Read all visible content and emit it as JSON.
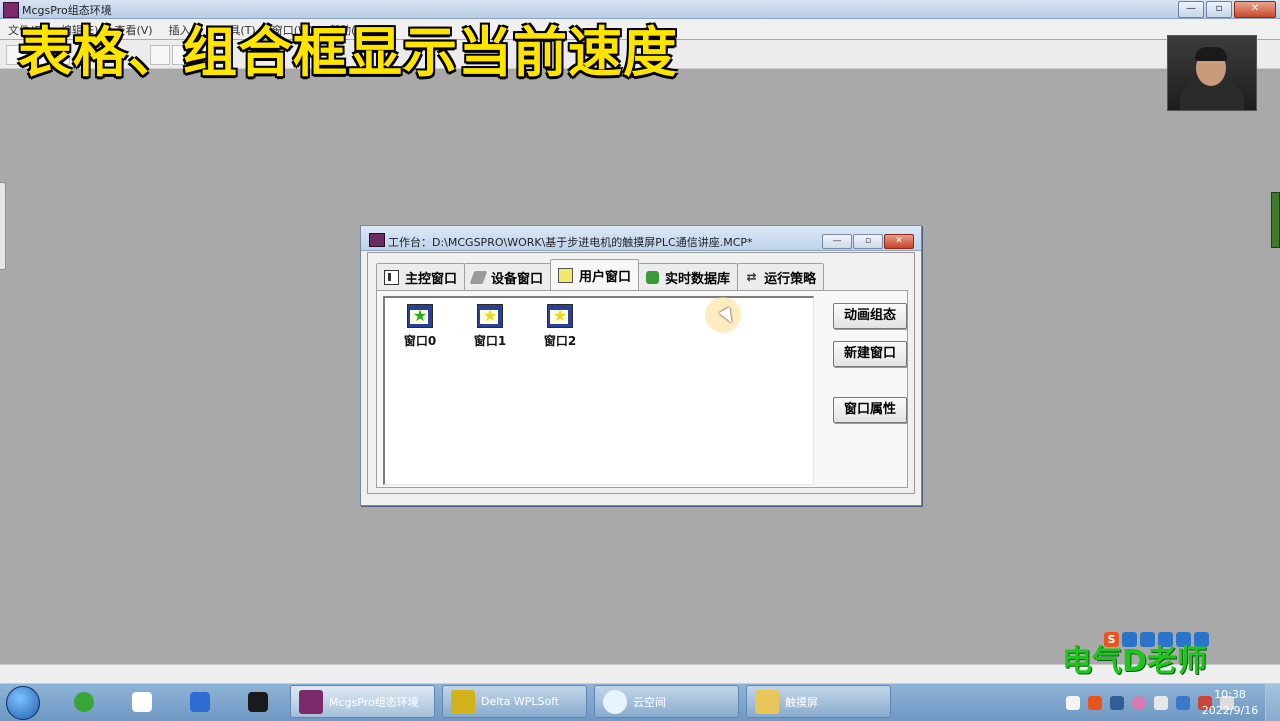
{
  "app": {
    "title": "McgsPro组态环境",
    "controls": {
      "minimize": "—",
      "maximize": "▫",
      "close": "✕"
    }
  },
  "menubar": [
    "文件(F)",
    "编辑(E)",
    "查看(V)",
    "插入(I)",
    "工具(T)",
    "窗口(W)",
    "帮助(H)"
  ],
  "overlay_caption": "表格、组合框显示当前速度",
  "workbench": {
    "title": "工作台：D:\\MCGSPRO\\WORK\\基于步进电机的触摸屏PLC通信讲座.MCP*",
    "controls": {
      "minimize": "—",
      "maximize": "▫",
      "close": "✕"
    },
    "tabs": [
      {
        "label": "主控窗口",
        "icon": "main-window-icon",
        "active": false
      },
      {
        "label": "设备窗口",
        "icon": "device-window-icon",
        "active": false
      },
      {
        "label": "用户窗口",
        "icon": "user-window-icon",
        "active": true
      },
      {
        "label": "实时数据库",
        "icon": "database-icon",
        "active": false
      },
      {
        "label": "运行策略",
        "icon": "strategy-icon",
        "active": false
      }
    ],
    "windows": [
      {
        "label": "窗口0",
        "star_color": "#22aa22"
      },
      {
        "label": "窗口1",
        "star_color": "#e8d81a"
      },
      {
        "label": "窗口2",
        "star_color": "#e8d81a"
      }
    ],
    "buttons": {
      "animate": "动画组态",
      "new_window": "新建窗口",
      "properties": "窗口属性"
    }
  },
  "watermark": "电气D老师",
  "taskbar": {
    "pinned": [
      "ie-icon",
      "baidu-netdisk-icon",
      "wps-icon",
      "obs-icon"
    ],
    "tasks": [
      {
        "label": "McgsPro组态环境",
        "icon": "mcgs-icon",
        "active": true
      },
      {
        "label": "Delta WPLSoft",
        "icon": "wplsoft-icon",
        "active": false
      },
      {
        "label": "云空间",
        "icon": "cloud-icon",
        "active": false
      },
      {
        "label": "触摸屏",
        "icon": "folder-icon",
        "active": false
      }
    ],
    "clock": {
      "time": "10:38",
      "date": "2022/9/16"
    }
  },
  "colors": {
    "caption": "#ffe400",
    "watermark": "#1fc51f",
    "background": "#a9a9a9"
  }
}
